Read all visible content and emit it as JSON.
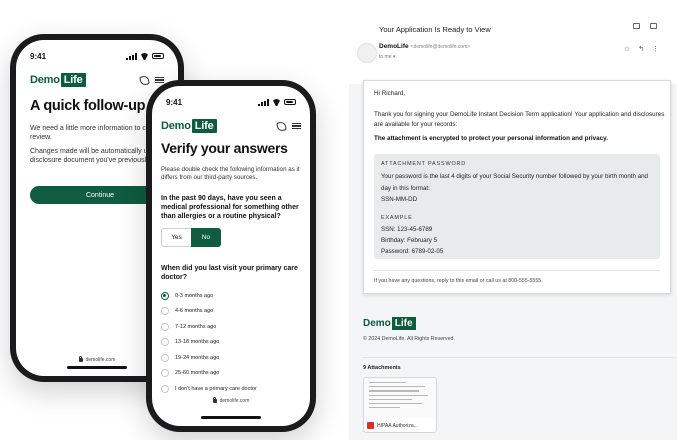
{
  "brand": {
    "demo": "Demo",
    "life": "Life",
    "footer_domain": "demolife.com"
  },
  "back_phone": {
    "time": "9:41",
    "title": "A quick follow-up",
    "para1": "We need a little more information to con your application review.",
    "para2": "Changes made will be automatically upd the application and disclosure document you've previously completed.",
    "button": "Continue"
  },
  "front_phone": {
    "time": "9:41",
    "title": "Verify your answers",
    "subtitle": "Please double check the following information as it differs from our third-party sources.",
    "question1": "In the past 90 days, have you seen a medical professional for something other than allergies or a routine physical?",
    "yes": "Yes",
    "no": "No",
    "question2": "When did you last visit your primary care doctor?",
    "options": [
      "0-3 months ago",
      "4-6 months ago",
      "7-12 months ago",
      "13-18 months ago",
      "19-24 months ago",
      "25-60 months ago",
      "I don't have a primary care doctor"
    ],
    "selected_index": 0
  },
  "email": {
    "subject": "Your Application Is Ready to View",
    "sender_name": "DemoLife",
    "sender_address": "<demolife@demolife.com>",
    "to": "to me ▾",
    "greeting": "Hi Richard,",
    "body1": "Thank you for signing your DemoLife Instant Decision Term application! Your application and disclosures are available for your records:",
    "body_bold": "The attachment is encrypted to protect your personal information and privacy.",
    "pw_label": "ATTACHMENT PASSWORD",
    "pw_text": "Your password is the last 4 digits of your Social Security number followed by your birth month and day in this format:",
    "pw_format": "SSN-MM-DD",
    "example_label": "EXAMPLE",
    "ex_ssn": "SSN: 123-45-6789",
    "ex_bday": "Birthday: February 5",
    "ex_pw": "Password: 6789-02-05",
    "footer": "If you have any questions, reply to this email or call us at 800-555-5555.",
    "copyright": "© 2024 DemoLife. All Rights Reserved.",
    "attachments_title": "9 Attachments",
    "attachment_name": "HIPAA Authoriza..."
  },
  "icons": {
    "print": "print-icon",
    "popout": "open-in-new-window-icon",
    "star": "star-icon",
    "reply": "reply-icon",
    "more": "more-vertical-icon",
    "phone": "phone-icon",
    "menu": "menu-icon",
    "lock": "lock-icon",
    "pdf": "pdf-icon"
  },
  "colors": {
    "brand_green": "#0f5c40",
    "page_bg": "#ffffff",
    "email_bg": "#f4f5f6",
    "pw_box": "#e9eaec"
  }
}
